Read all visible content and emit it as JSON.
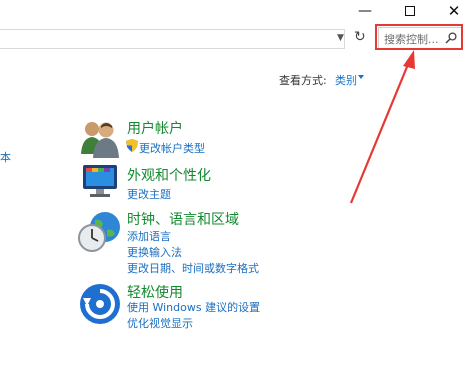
{
  "window": {
    "minimize": "—",
    "maximize": "☐",
    "close": "✕"
  },
  "search": {
    "placeholder": "搜索控制..."
  },
  "view_by": {
    "label": "查看方式:",
    "value": "类别"
  },
  "left_fragment": "本",
  "categories": [
    {
      "title": "用户帐户",
      "links": [
        "更改帐户类型"
      ],
      "icon": "user-accounts-icon"
    },
    {
      "title": "外观和个性化",
      "links": [
        "更改主题"
      ],
      "icon": "appearance-icon"
    },
    {
      "title": "时钟、语言和区域",
      "links": [
        "添加语言",
        "更换输入法",
        "更改日期、时间或数字格式"
      ],
      "icon": "clock-globe-icon"
    },
    {
      "title": "轻松使用",
      "links": [
        "使用 Windows 建议的设置",
        "优化视觉显示"
      ],
      "icon": "ease-of-access-icon"
    }
  ],
  "colors": {
    "highlight": "#e53935",
    "category_title": "#128a2e",
    "link": "#1a6fc2"
  }
}
